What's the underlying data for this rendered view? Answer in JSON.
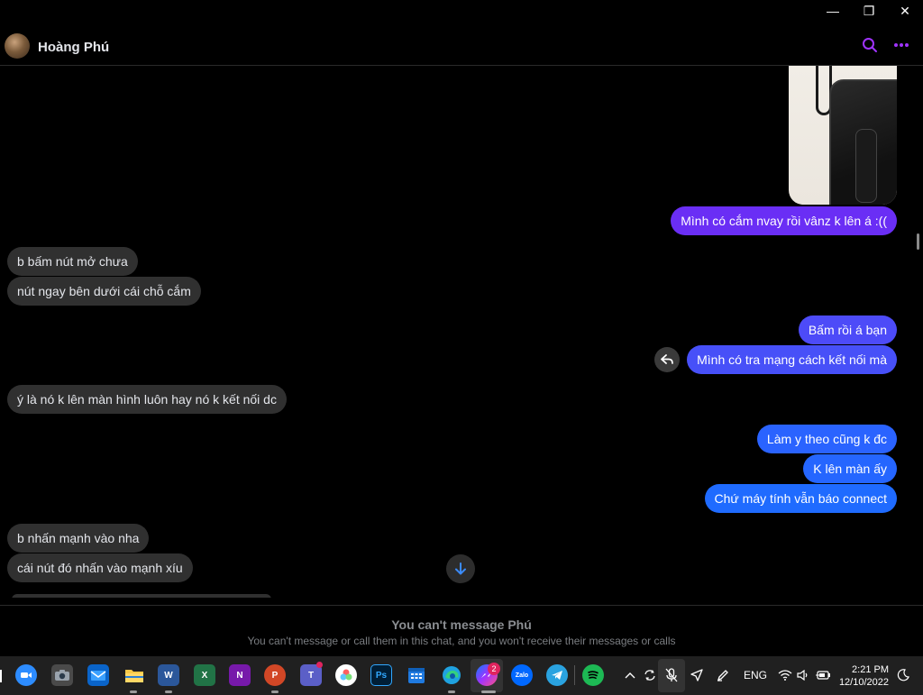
{
  "window": {
    "minimize": "—",
    "restore": "❐",
    "close": "✕"
  },
  "header": {
    "contact_name": "Hoàng Phú",
    "search_icon": "search-icon",
    "more_icon": "more-icon"
  },
  "colors": {
    "accent": "#a033ff",
    "bubble_purple": "#6a2ef5",
    "bubble_blue": "#1f6bff",
    "incoming": "#303030"
  },
  "messages": [
    {
      "side": "out",
      "text": "Mình có cắm nvay rồi vânz k lên á :(("
    },
    {
      "side": "in",
      "text": "b bấm nút mở chưa"
    },
    {
      "side": "in",
      "text": "nút ngay bên dưới cái chỗ cắm"
    },
    {
      "side": "out",
      "text": "Bấm rồi á bạn"
    },
    {
      "side": "out",
      "text": "Mình có tra mạng cách kết nối mà"
    },
    {
      "side": "in",
      "text": "ý là nó k lên màn hình luôn hay nó k kết nối dc"
    },
    {
      "side": "out",
      "text": "Làm y theo cũng k đc"
    },
    {
      "side": "out",
      "text": "K lên màn ấy"
    },
    {
      "side": "out",
      "text": "Chứ máy tính vẫn báo connect"
    },
    {
      "side": "in",
      "text": "b nhấn mạnh vào nha"
    },
    {
      "side": "in",
      "text": "cái nút đó nhấn vào mạnh xíu"
    }
  ],
  "notice": {
    "title": "You can't message Phú",
    "subtitle": "You can't message or call them in this chat, and you won't receive their messages or calls"
  },
  "taskbar": {
    "apps": [
      "zoom",
      "camera",
      "mail",
      "file-explorer",
      "word",
      "excel",
      "onenote",
      "powerpoint",
      "teams",
      "photos",
      "photoshop",
      "calendar",
      "edge",
      "messenger",
      "zalo",
      "telegram",
      "spotify"
    ],
    "labels": {
      "word": "W",
      "excel": "X",
      "onenote": "N",
      "powerpoint": "P",
      "teams": "T",
      "photoshop": "Ps",
      "zalo": "Zalo"
    },
    "messenger_badge": "2",
    "language": "ENG",
    "time": "2:21 PM",
    "date": "12/10/2022"
  }
}
